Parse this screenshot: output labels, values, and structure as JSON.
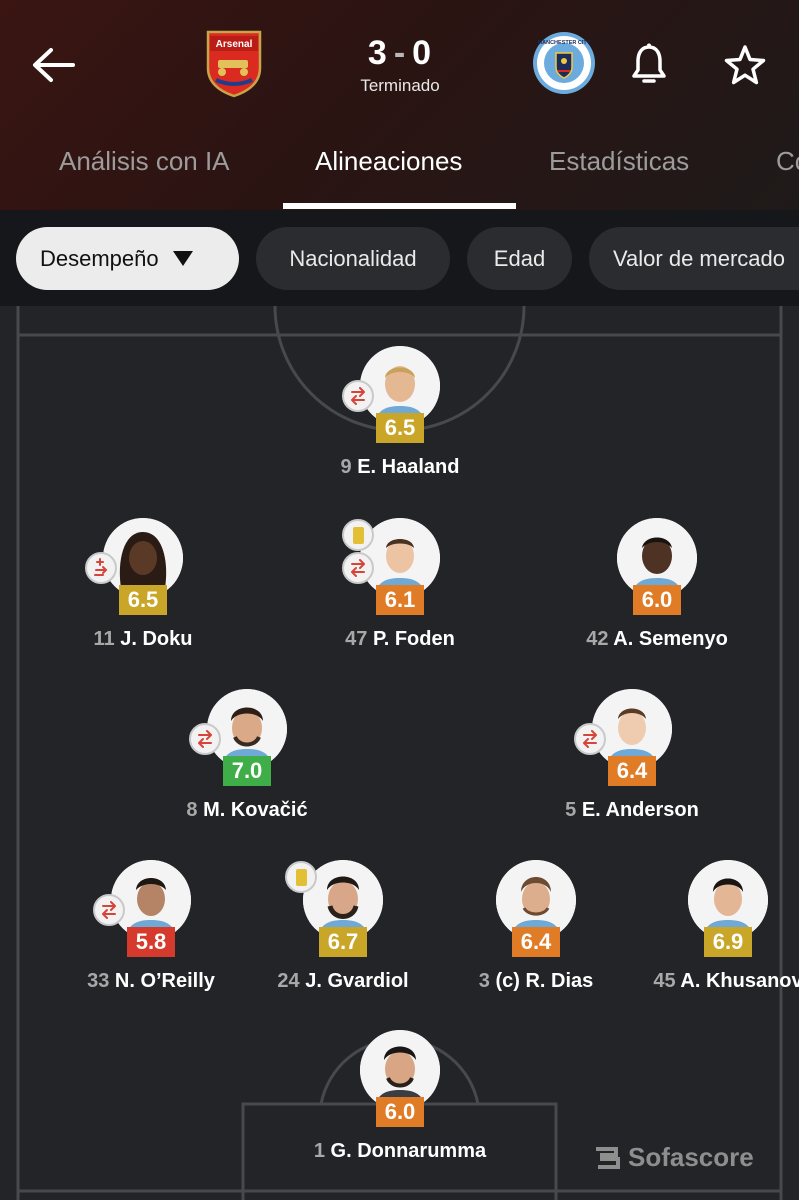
{
  "header": {
    "home_team": "Arsenal",
    "home_crest_text": "Arsenal",
    "away_team": "Manchester City",
    "away_crest_text": "MANCHESTER CITY",
    "score_home": "3",
    "score_sep": "-",
    "score_away": "0",
    "status": "Terminado"
  },
  "tabs": [
    {
      "label": "Análisis con IA",
      "active": false
    },
    {
      "label": "Alineaciones",
      "active": true
    },
    {
      "label": "Estadísticas",
      "active": false
    },
    {
      "label": "Co",
      "active": false
    }
  ],
  "filters": [
    {
      "label": "Desempeño",
      "selected": true
    },
    {
      "label": "Nacionalidad",
      "selected": false
    },
    {
      "label": "Edad",
      "selected": false
    },
    {
      "label": "Valor de mercado",
      "selected": false
    }
  ],
  "colors": {
    "rating_yellow": "#c9a528",
    "rating_orange": "#e07b26",
    "rating_green": "#3fae49",
    "rating_red": "#d63a2c",
    "substitution_arrow": "#d6443a"
  },
  "players": [
    {
      "number": "9",
      "name": "E. Haaland",
      "rating": "6.5",
      "rating_color": "yellow",
      "sub_icon": "substitution-icon",
      "yellow_card": false
    },
    {
      "number": "11",
      "name": "J. Doku",
      "rating": "6.5",
      "rating_color": "yellow",
      "sub_icon": "substitution-plus-minus-icon",
      "yellow_card": false
    },
    {
      "number": "47",
      "name": "P. Foden",
      "rating": "6.1",
      "rating_color": "orange",
      "sub_icon": "substitution-icon",
      "yellow_card": true
    },
    {
      "number": "42",
      "name": "A. Semenyo",
      "rating": "6.0",
      "rating_color": "orange",
      "sub_icon": null,
      "yellow_card": false
    },
    {
      "number": "8",
      "name": "M. Kovačić",
      "rating": "7.0",
      "rating_color": "green",
      "sub_icon": "substitution-icon",
      "yellow_card": false
    },
    {
      "number": "5",
      "name": "E. Anderson",
      "rating": "6.4",
      "rating_color": "orange",
      "sub_icon": "substitution-icon",
      "yellow_card": false
    },
    {
      "number": "33",
      "name": "N. O’Reilly",
      "rating": "5.8",
      "rating_color": "red",
      "sub_icon": "substitution-icon",
      "yellow_card": false
    },
    {
      "number": "24",
      "name": "J. Gvardiol",
      "rating": "6.7",
      "rating_color": "yellow",
      "sub_icon": null,
      "yellow_card": true
    },
    {
      "number": "3",
      "name": "(c) R. Dias",
      "rating": "6.4",
      "rating_color": "orange",
      "sub_icon": null,
      "yellow_card": false
    },
    {
      "number": "45",
      "name": "A. Khusanov",
      "rating": "6.9",
      "rating_color": "yellow",
      "sub_icon": null,
      "yellow_card": false
    },
    {
      "number": "1",
      "name": "G. Donnarumma",
      "rating": "6.0",
      "rating_color": "orange",
      "sub_icon": null,
      "yellow_card": false
    }
  ],
  "watermark": "Sofascore"
}
